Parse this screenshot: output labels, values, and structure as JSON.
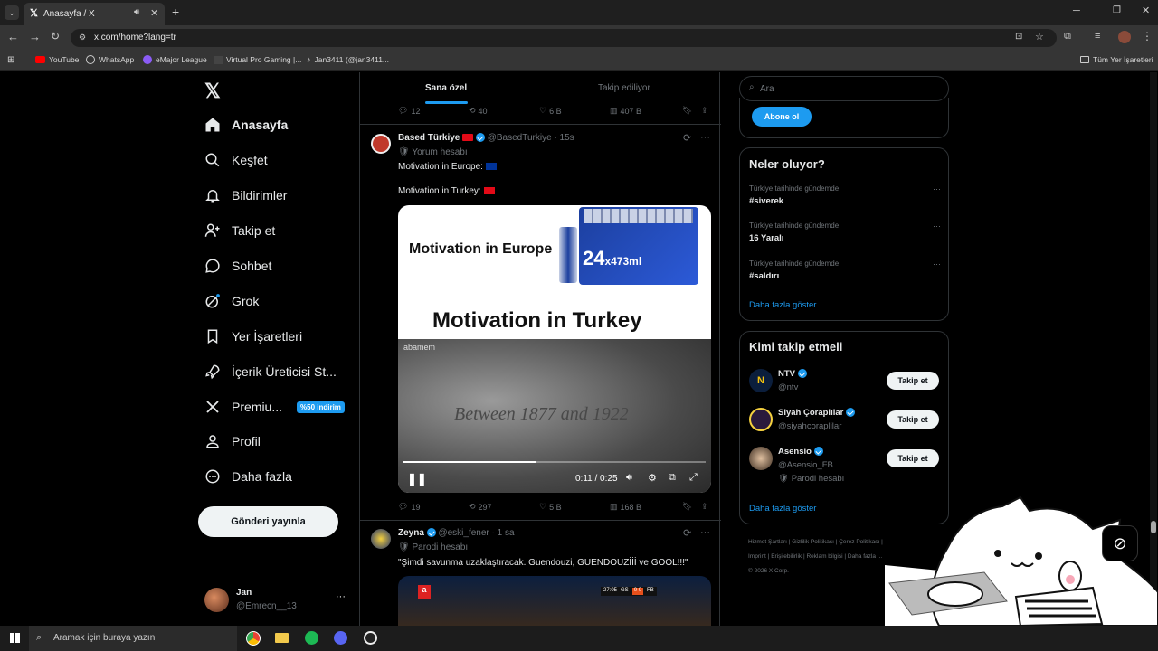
{
  "browser": {
    "tab_title": "Anasayfa / X",
    "url": "x.com/home?lang=tr",
    "bookmarks": [
      "YouTube",
      "WhatsApp",
      "eMajor League",
      "Virtual Pro Gaming |...",
      "Jan3411 (@jan3411..."
    ],
    "all_bookmarks": "Tüm Yer İşaretleri"
  },
  "sidebar": {
    "items": [
      {
        "label": "Anasayfa",
        "icon": "home-icon"
      },
      {
        "label": "Keşfet",
        "icon": "search-icon"
      },
      {
        "label": "Bildirimler",
        "icon": "bell-icon"
      },
      {
        "label": "Takip et",
        "icon": "add-user-icon"
      },
      {
        "label": "Sohbet",
        "icon": "chat-icon"
      },
      {
        "label": "Grok",
        "icon": "grok-icon"
      },
      {
        "label": "Yer İşaretleri",
        "icon": "bookmark-icon"
      },
      {
        "label": "İçerik Üreticisi St...",
        "icon": "rocket-icon"
      },
      {
        "label": "Premiu...",
        "icon": "x-logo-icon"
      },
      {
        "label": "Profil",
        "icon": "profile-icon"
      },
      {
        "label": "Daha fazla",
        "icon": "more-circle-icon"
      }
    ],
    "premium_badge": "%50 indirim",
    "post_button": "Gönderi yayınla",
    "account": {
      "name": "Jan",
      "handle": "@Emrecn__13"
    }
  },
  "feed": {
    "tabs": [
      "Sana özel",
      "Takip ediliyor"
    ],
    "prev_actions": {
      "replies": "12",
      "reposts": "40",
      "likes": "6 B",
      "views": "407 B"
    },
    "post1": {
      "name": "Based Türkiye",
      "handle": "@BasedTurkiye",
      "time": "· 15s",
      "label": "Yorum hesabı",
      "line1": "Motivation in Europe:",
      "line2": "Motivation in Turkey:",
      "video_text_top": "Motivation in Europe",
      "can_text": "24",
      "can_subtext": "x473ml",
      "video_text_mid": "Motivation in Turkey",
      "video_overlay": "Between 1877 and 1922",
      "watermark": "abamem",
      "time_display": "0:11 / 0:25",
      "progress": 0.44,
      "replies": "19",
      "reposts": "297",
      "likes": "5 B",
      "views": "168 B"
    },
    "post2": {
      "name": "Zeyna",
      "handle": "@eski_fener",
      "time": "· 1 sa",
      "label": "Parodi hesabı",
      "text": "\"Şimdi savunma uzaklaştıracak. Guendouzi, GUENDOUZİİİ ve GOOL!!!\"",
      "score_home": "GS",
      "score_away": "FB",
      "score_clock": "27:05",
      "score_value": "0 0"
    }
  },
  "right": {
    "search_placeholder": "Ara",
    "subscribe": "Abone ol",
    "trends_title": "Neler oluyor?",
    "trends": [
      {
        "context": "Türkiye tarihinde gündemde",
        "topic": "#siverek"
      },
      {
        "context": "Türkiye tarihinde gündemde",
        "topic": "16 Yaralı"
      },
      {
        "context": "Türkiye tarihinde gündemde",
        "topic": "#saldırı"
      }
    ],
    "show_more": "Daha fazla göster",
    "follow_title": "Kimi takip etmeli",
    "follow": [
      {
        "name": "NTV",
        "handle": "@ntv",
        "label": ""
      },
      {
        "name": "Siyah Çoraplılar",
        "handle": "@siyahcoraplilar",
        "label": ""
      },
      {
        "name": "Asensio",
        "handle": "@Asensio_FB",
        "label": "Parodi hesabı"
      }
    ],
    "follow_btn": "Takip et",
    "follow_more": "Daha fazla göster",
    "footer": [
      "Hizmet Şartları",
      "Gizlilik Politikası",
      "Çerez Politikası",
      "Imprint",
      "Erişilebilirlik",
      "Reklam bilgisi",
      "Daha fazla ...",
      "© 2026 X Corp."
    ]
  },
  "taskbar": {
    "search": "Aramak için buraya yazın"
  },
  "colors": {
    "accent": "#1d9bf0",
    "bg": "#000000",
    "border": "#2f3336",
    "muted": "#71767b"
  }
}
